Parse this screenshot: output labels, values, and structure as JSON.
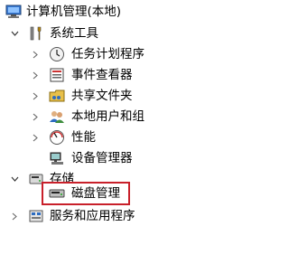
{
  "tree": {
    "root": "计算机管理(本地)",
    "system_tools": {
      "label": "系统工具",
      "children": [
        {
          "label": "任务计划程序",
          "icon": "clock-icon"
        },
        {
          "label": "事件查看器",
          "icon": "event-viewer-icon"
        },
        {
          "label": "共享文件夹",
          "icon": "shared-folder-icon"
        },
        {
          "label": "本地用户和组",
          "icon": "users-icon"
        },
        {
          "label": "性能",
          "icon": "performance-icon"
        },
        {
          "label": "设备管理器",
          "icon": "device-manager-icon"
        }
      ]
    },
    "storage": {
      "label": "存储",
      "children": [
        {
          "label": "磁盘管理",
          "icon": "disk-icon"
        }
      ]
    },
    "services": {
      "label": "服务和应用程序",
      "icon": "services-icon"
    }
  },
  "colors": {
    "selection_border": "#c8202a"
  }
}
